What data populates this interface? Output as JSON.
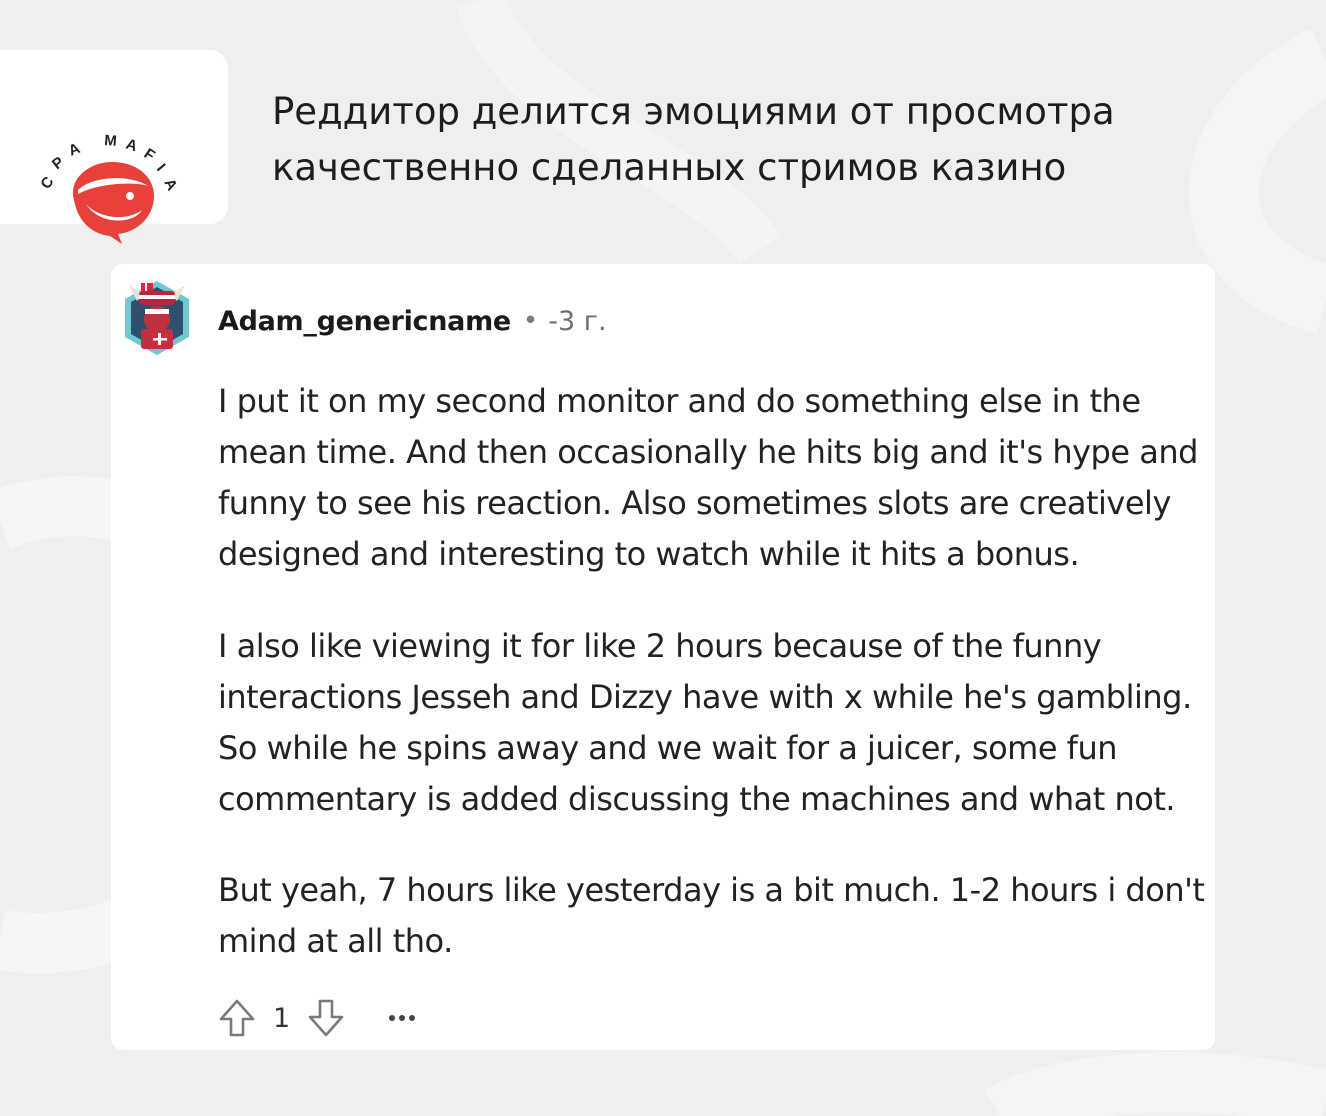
{
  "brand": {
    "logo_text": "CPA MAFIA",
    "accent_color": "#e8413c"
  },
  "header": {
    "title_lines": [
      "Реддитор делится эмоциями от просмотра",
      "качественно сделанных стримов казино"
    ]
  },
  "comment": {
    "username": "Adam_genericname",
    "separator": "•",
    "age": "-3 г.",
    "paragraphs": [
      [
        "I put it on my second monitor and do something else in the",
        "mean time. And then occasionally he hits big and it's hype and",
        "funny to see his reaction. Also sometimes slots are creatively",
        "designed and interesting to watch while it hits a bonus."
      ],
      [
        "I also like viewing it for like 2 hours because of the funny",
        "interactions Jesseh and Dizzy have with x while he's gambling.",
        "So while he spins away and we wait for a juicer, some fun",
        "commentary is added discussing the machines and what not."
      ],
      [
        "But yeah, 7 hours like yesterday is a bit much. 1-2 hours i don't",
        "mind at all tho."
      ]
    ],
    "score": "1",
    "icons": {
      "upvote": "upvote-arrow-icon",
      "downvote": "downvote-arrow-icon",
      "more": "more-options-icon"
    }
  }
}
